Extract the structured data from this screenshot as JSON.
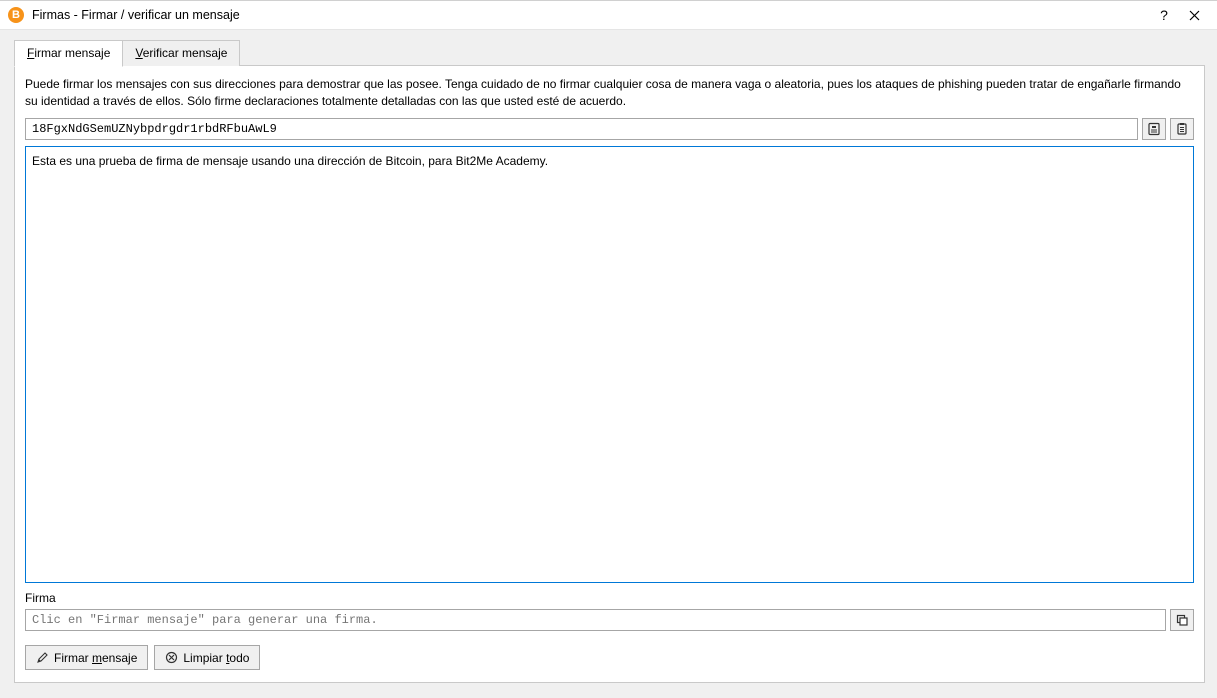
{
  "window": {
    "title": "Firmas - Firmar / verificar un mensaje",
    "app_icon_letter": "B"
  },
  "tabs": {
    "sign_prefix": "F",
    "sign_rest": "irmar mensaje",
    "verify_prefix": "V",
    "verify_rest": "erificar mensaje"
  },
  "info_text": "Puede firmar los mensajes con sus direcciones para demostrar que las posee. Tenga cuidado de no firmar cualquier cosa de manera vaga o aleatoria, pues los ataques de phishing pueden tratar de engañarle firmando su identidad a través de ellos. Sólo firme declaraciones totalmente detalladas con las que usted esté de acuerdo.",
  "address": {
    "value": "18FgxNdGSemUZNybpdrgdr1rbdRFbuAwL9"
  },
  "message": {
    "value": "Esta es una prueba de firma de mensaje usando una dirección de Bitcoin, para Bit2Me Academy."
  },
  "signature": {
    "label": "Firma",
    "placeholder": "Clic en \"Firmar mensaje\" para generar una firma."
  },
  "buttons": {
    "sign_prefix": "Firmar ",
    "sign_ul": "m",
    "sign_rest": "ensaje",
    "clear_prefix": "Limpiar ",
    "clear_ul": "t",
    "clear_rest": "odo"
  }
}
